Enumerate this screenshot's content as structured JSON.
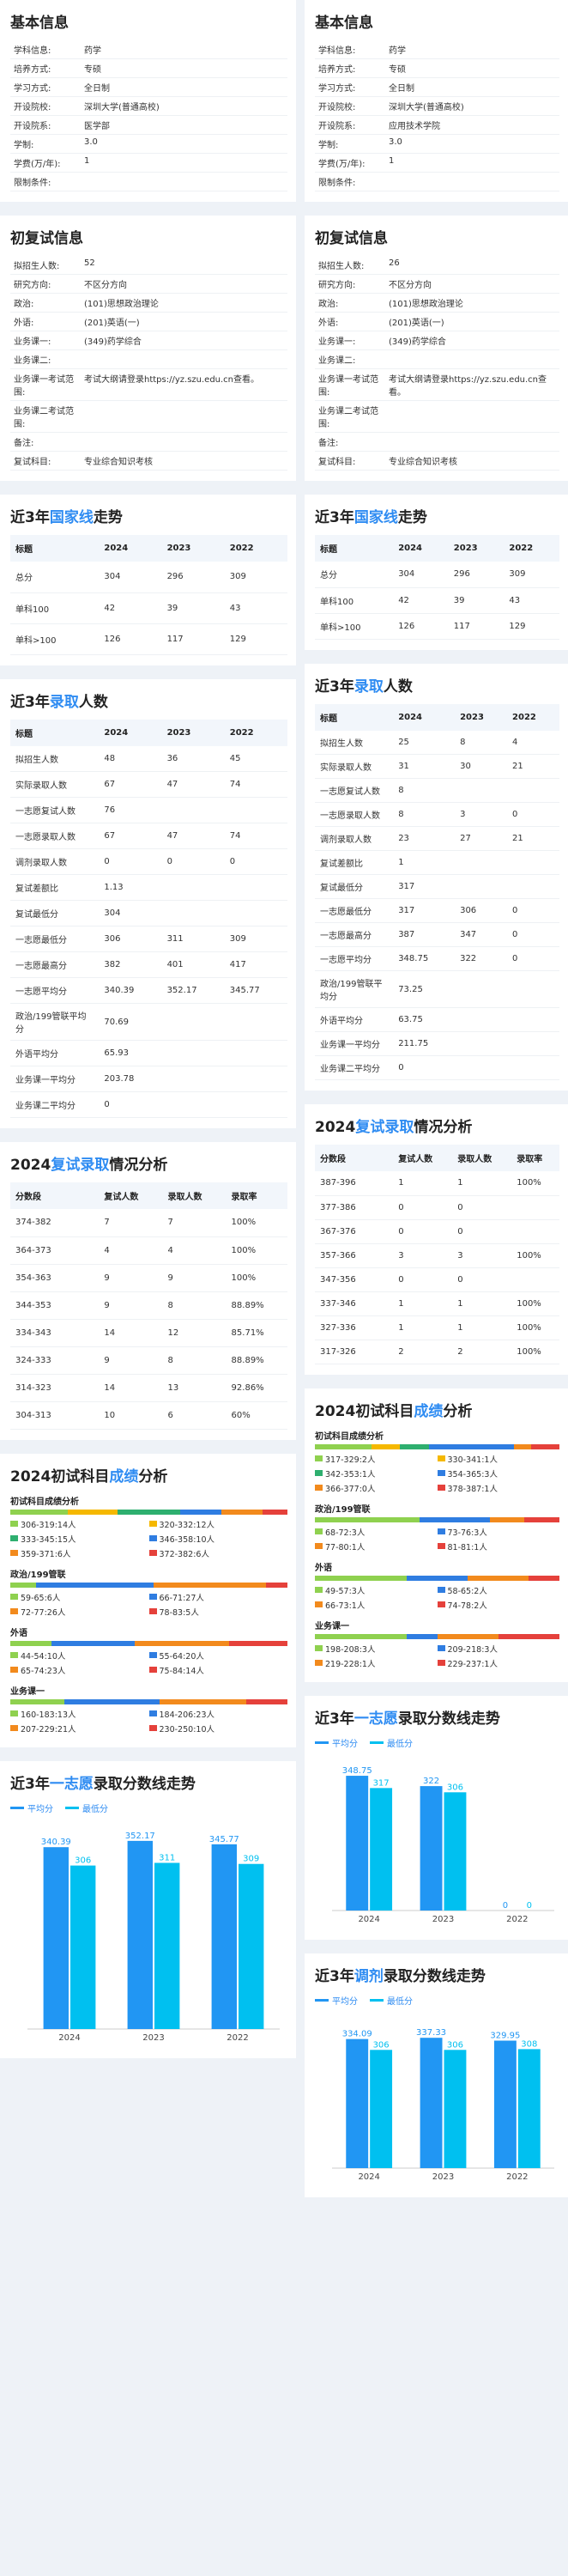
{
  "colors": {
    "accent": "#2f8cf2",
    "bar1": "#2196f3",
    "bar2": "#00c0f0",
    "seg": [
      "#8fd14f",
      "#f5b800",
      "#2eaf6f",
      "#2f7de1",
      "#f28a1d",
      "#e5413b"
    ]
  },
  "left": {
    "basic": {
      "title": "基本信息",
      "rows": [
        [
          "学科信息:",
          "药学"
        ],
        [
          "培养方式:",
          "专硕"
        ],
        [
          "学习方式:",
          "全日制"
        ],
        [
          "开设院校:",
          "深圳大学(普通高校)"
        ],
        [
          "开设院系:",
          "医学部"
        ],
        [
          "学制:",
          "3.0"
        ],
        [
          "学费(万/年):",
          "1"
        ],
        [
          "限制条件:",
          ""
        ]
      ]
    },
    "exam": {
      "title": "初复试信息",
      "rows": [
        [
          "拟招生人数:",
          "52"
        ],
        [
          "研究方向:",
          "不区分方向"
        ],
        [
          "政治:",
          "(101)思想政治理论"
        ],
        [
          "外语:",
          "(201)英语(一)"
        ],
        [
          "业务课一:",
          "(349)药学综合"
        ],
        [
          "业务课二:",
          ""
        ],
        [
          "业务课一考试范围:",
          "考试大纲请登录https://yz.szu.edu.cn查看。"
        ],
        [
          "业务课二考试范围:",
          ""
        ],
        [
          "备注:",
          ""
        ],
        [
          "复试科目:",
          "专业综合知识考核"
        ]
      ]
    },
    "national": {
      "title_a": "近3年",
      "title_b": "国家线",
      "title_c": "走势",
      "head": [
        "标题",
        "2024",
        "2023",
        "2022"
      ],
      "rows": [
        [
          "总分",
          "304",
          "296",
          "309"
        ],
        [
          "单科100",
          "42",
          "39",
          "43"
        ],
        [
          "单科>100",
          "126",
          "117",
          "129"
        ]
      ]
    },
    "admit": {
      "title_a": "近3年",
      "title_b": "录取",
      "title_c": "人数",
      "head": [
        "标题",
        "2024",
        "2023",
        "2022"
      ],
      "rows": [
        [
          "拟招生人数",
          "48",
          "36",
          "45"
        ],
        [
          "实际录取人数",
          "67",
          "47",
          "74"
        ],
        [
          "一志愿复试人数",
          "76",
          "",
          ""
        ],
        [
          "一志愿录取人数",
          "67",
          "47",
          "74"
        ],
        [
          "调剂录取人数",
          "0",
          "0",
          "0"
        ],
        [
          "复试差额比",
          "1.13",
          "",
          ""
        ],
        [
          "复试最低分",
          "304",
          "",
          ""
        ],
        [
          "一志愿最低分",
          "306",
          "311",
          "309"
        ],
        [
          "一志愿最高分",
          "382",
          "401",
          "417"
        ],
        [
          "一志愿平均分",
          "340.39",
          "352.17",
          "345.77"
        ],
        [
          "政治/199管联平均分",
          "70.69",
          "",
          ""
        ],
        [
          "外语平均分",
          "65.93",
          "",
          ""
        ],
        [
          "业务课一平均分",
          "203.78",
          "",
          ""
        ],
        [
          "业务课二平均分",
          "0",
          "",
          ""
        ]
      ]
    },
    "retest": {
      "title_a": "2024",
      "title_b": "复试录取",
      "title_c": "情况分析",
      "head": [
        "分数段",
        "复试人数",
        "录取人数",
        "录取率"
      ],
      "rows": [
        [
          "374-382",
          "7",
          "7",
          "100%"
        ],
        [
          "364-373",
          "4",
          "4",
          "100%"
        ],
        [
          "354-363",
          "9",
          "9",
          "100%"
        ],
        [
          "344-353",
          "9",
          "8",
          "88.89%"
        ],
        [
          "334-343",
          "14",
          "12",
          "85.71%"
        ],
        [
          "324-333",
          "9",
          "8",
          "88.89%"
        ],
        [
          "314-323",
          "14",
          "13",
          "92.86%"
        ],
        [
          "304-313",
          "10",
          "6",
          "60%"
        ]
      ]
    },
    "scores": {
      "title_a": "2024初试科目",
      "title_b": "成绩",
      "title_c": "分析",
      "groups": [
        {
          "name": "初试科目成绩分析",
          "weights": [
            14,
            12,
            15,
            10,
            10,
            6
          ],
          "items": [
            "306-319:14人",
            "320-332:12人",
            "333-345:15人",
            "346-358:10人",
            "359-371:6人",
            "372-382:6人"
          ]
        },
        {
          "name": "政治/199管联",
          "weights": [
            6,
            27,
            26,
            5
          ],
          "items": [
            "59-65:6人",
            "66-71:27人",
            "72-77:26人",
            "78-83:5人"
          ],
          "cidx": [
            0,
            3,
            4,
            5
          ]
        },
        {
          "name": "外语",
          "weights": [
            10,
            20,
            23,
            14
          ],
          "items": [
            "44-54:10人",
            "55-64:20人",
            "65-74:23人",
            "75-84:14人"
          ],
          "cidx": [
            0,
            3,
            4,
            5
          ]
        },
        {
          "name": "业务课一",
          "weights": [
            13,
            23,
            21,
            10
          ],
          "items": [
            "160-183:13人",
            "184-206:23人",
            "207-229:21人",
            "230-250:10人"
          ],
          "cidx": [
            0,
            3,
            4,
            5
          ]
        }
      ]
    },
    "trend": {
      "title_a": "近3年",
      "title_b": "一志愿",
      "title_c": "录取分数线走势",
      "legend": [
        "平均分",
        "最低分"
      ],
      "chart_data": {
        "type": "bar",
        "categories": [
          "2024",
          "2023",
          "2022"
        ],
        "series": [
          {
            "name": "平均分",
            "values": [
              340.39,
              352.17,
              345.77
            ]
          },
          {
            "name": "最低分",
            "values": [
              306,
              311,
              309
            ]
          }
        ],
        "ylim": [
          0,
          360
        ]
      }
    }
  },
  "right": {
    "basic": {
      "title": "基本信息",
      "rows": [
        [
          "学科信息:",
          "药学"
        ],
        [
          "培养方式:",
          "专硕"
        ],
        [
          "学习方式:",
          "全日制"
        ],
        [
          "开设院校:",
          "深圳大学(普通高校)"
        ],
        [
          "开设院系:",
          "应用技术学院"
        ],
        [
          "学制:",
          "3.0"
        ],
        [
          "学费(万/年):",
          "1"
        ],
        [
          "限制条件:",
          ""
        ]
      ]
    },
    "exam": {
      "title": "初复试信息",
      "rows": [
        [
          "拟招生人数:",
          "26"
        ],
        [
          "研究方向:",
          "不区分方向"
        ],
        [
          "政治:",
          "(101)思想政治理论"
        ],
        [
          "外语:",
          "(201)英语(一)"
        ],
        [
          "业务课一:",
          "(349)药学综合"
        ],
        [
          "业务课二:",
          ""
        ],
        [
          "业务课一考试范围:",
          "考试大纲请登录https://yz.szu.edu.cn查看。"
        ],
        [
          "业务课二考试范围:",
          ""
        ],
        [
          "备注:",
          ""
        ],
        [
          "复试科目:",
          "专业综合知识考核"
        ]
      ]
    },
    "national": {
      "title_a": "近3年",
      "title_b": "国家线",
      "title_c": "走势",
      "head": [
        "标题",
        "2024",
        "2023",
        "2022"
      ],
      "rows": [
        [
          "总分",
          "304",
          "296",
          "309"
        ],
        [
          "单科100",
          "42",
          "39",
          "43"
        ],
        [
          "单科>100",
          "126",
          "117",
          "129"
        ]
      ]
    },
    "admit": {
      "title_a": "近3年",
      "title_b": "录取",
      "title_c": "人数",
      "head": [
        "标题",
        "2024",
        "2023",
        "2022"
      ],
      "rows": [
        [
          "拟招生人数",
          "25",
          "8",
          "4"
        ],
        [
          "实际录取人数",
          "31",
          "30",
          "21"
        ],
        [
          "一志愿复试人数",
          "8",
          "",
          ""
        ],
        [
          "一志愿录取人数",
          "8",
          "3",
          "0"
        ],
        [
          "调剂录取人数",
          "23",
          "27",
          "21"
        ],
        [
          "复试差额比",
          "1",
          "",
          ""
        ],
        [
          "复试最低分",
          "317",
          "",
          ""
        ],
        [
          "一志愿最低分",
          "317",
          "306",
          "0"
        ],
        [
          "一志愿最高分",
          "387",
          "347",
          "0"
        ],
        [
          "一志愿平均分",
          "348.75",
          "322",
          "0"
        ],
        [
          "政治/199管联平均分",
          "73.25",
          "",
          ""
        ],
        [
          "外语平均分",
          "63.75",
          "",
          ""
        ],
        [
          "业务课一平均分",
          "211.75",
          "",
          ""
        ],
        [
          "业务课二平均分",
          "0",
          "",
          ""
        ]
      ]
    },
    "retest": {
      "title_a": "2024",
      "title_b": "复试录取",
      "title_c": "情况分析",
      "head": [
        "分数段",
        "复试人数",
        "录取人数",
        "录取率"
      ],
      "rows": [
        [
          "387-396",
          "1",
          "1",
          "100%"
        ],
        [
          "377-386",
          "0",
          "0",
          ""
        ],
        [
          "367-376",
          "0",
          "0",
          ""
        ],
        [
          "357-366",
          "3",
          "3",
          "100%"
        ],
        [
          "347-356",
          "0",
          "0",
          ""
        ],
        [
          "337-346",
          "1",
          "1",
          "100%"
        ],
        [
          "327-336",
          "1",
          "1",
          "100%"
        ],
        [
          "317-326",
          "2",
          "2",
          "100%"
        ]
      ]
    },
    "scores": {
      "title_a": "2024初试科目",
      "title_b": "成绩",
      "title_c": "分析",
      "groups": [
        {
          "name": "初试科目成绩分析",
          "weights": [
            2,
            1,
            1,
            3,
            0.6,
            1
          ],
          "items": [
            "317-329:2人",
            "330-341:1人",
            "342-353:1人",
            "354-365:3人",
            "366-377:0人",
            "378-387:1人"
          ]
        },
        {
          "name": "政治/199管联",
          "weights": [
            3,
            2,
            1,
            1
          ],
          "items": [
            "68-72:3人",
            "73-76:3人",
            "77-80:1人",
            "81-81:1人"
          ],
          "cidx": [
            0,
            3,
            4,
            5
          ]
        },
        {
          "name": "外语",
          "weights": [
            3,
            2,
            2,
            1
          ],
          "items": [
            "49-57:3人",
            "58-65:2人",
            "66-73:1人",
            "74-78:2人"
          ],
          "cidx": [
            0,
            3,
            4,
            5
          ]
        },
        {
          "name": "业务课一",
          "weights": [
            3,
            1,
            2,
            2
          ],
          "items": [
            "198-208:3人",
            "209-218:3人",
            "219-228:1人",
            "229-237:1人"
          ],
          "cidx": [
            0,
            3,
            4,
            5
          ]
        }
      ]
    },
    "trend1": {
      "title_a": "近3年",
      "title_b": "一志愿",
      "title_c": "录取分数线走势",
      "legend": [
        "平均分",
        "最低分"
      ],
      "chart_data": {
        "type": "bar",
        "categories": [
          "2024",
          "2023",
          "2022"
        ],
        "series": [
          {
            "name": "平均分",
            "values": [
              348.75,
              322,
              0
            ]
          },
          {
            "name": "最低分",
            "values": [
              317,
              306,
              0
            ]
          }
        ],
        "ylim": [
          0,
          360
        ]
      }
    },
    "trend2": {
      "title_a": "近3年",
      "title_b": "调剂",
      "title_c": "录取分数线走势",
      "legend": [
        "平均分",
        "最低分"
      ],
      "chart_data": {
        "type": "bar",
        "categories": [
          "2024",
          "2023",
          "2022"
        ],
        "series": [
          {
            "name": "平均分",
            "values": [
              334.09,
              337.33,
              329.95
            ]
          },
          {
            "name": "最低分",
            "values": [
              306,
              306,
              308
            ]
          }
        ],
        "ylim": [
          0,
          360
        ]
      }
    }
  }
}
